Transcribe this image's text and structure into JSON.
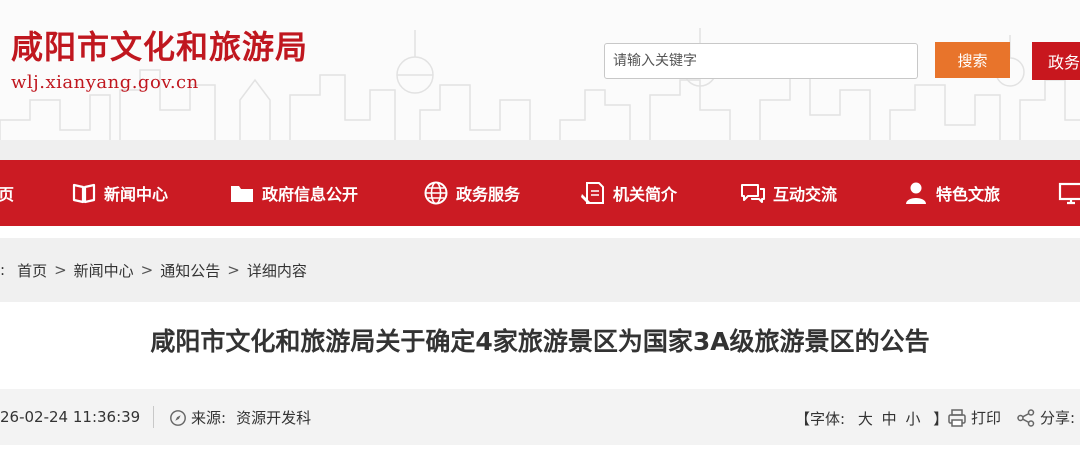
{
  "header": {
    "site_title": "咸阳市文化和旅游局",
    "site_domain": "wlj.xianyang.gov.cn",
    "search_placeholder": "请输入关键字",
    "search_button": "搜索",
    "gov_service_button": "政务"
  },
  "nav": {
    "items": [
      {
        "label": "页",
        "icon": "home-icon"
      },
      {
        "label": "新闻中心",
        "icon": "book-icon"
      },
      {
        "label": "政府信息公开",
        "icon": "folder-icon"
      },
      {
        "label": "政务服务",
        "icon": "globe-icon"
      },
      {
        "label": "机关简介",
        "icon": "document-icon"
      },
      {
        "label": "互动交流",
        "icon": "chat-icon"
      },
      {
        "label": "特色文旅",
        "icon": "person-icon"
      }
    ]
  },
  "breadcrumb": {
    "lead": ":",
    "items": [
      "首页",
      "新闻中心",
      "通知公告",
      "详细内容"
    ],
    "separator": ">"
  },
  "article": {
    "title": "咸阳市文化和旅游局关于确定4家旅游景区为国家3A级旅游景区的公告",
    "date": "26-02-24 11:36:39",
    "source_label": "来源:",
    "source_value": "资源开发科",
    "font_size_label": "【字体:",
    "font_size_options": [
      "大",
      "中",
      "小"
    ],
    "font_size_end": "】",
    "print_label": "打印",
    "share_label": "分享:"
  },
  "colors": {
    "brand_red": "#cb1b23",
    "search_orange": "#e8742b",
    "breadcrumb_bg": "#f0f0f0"
  }
}
